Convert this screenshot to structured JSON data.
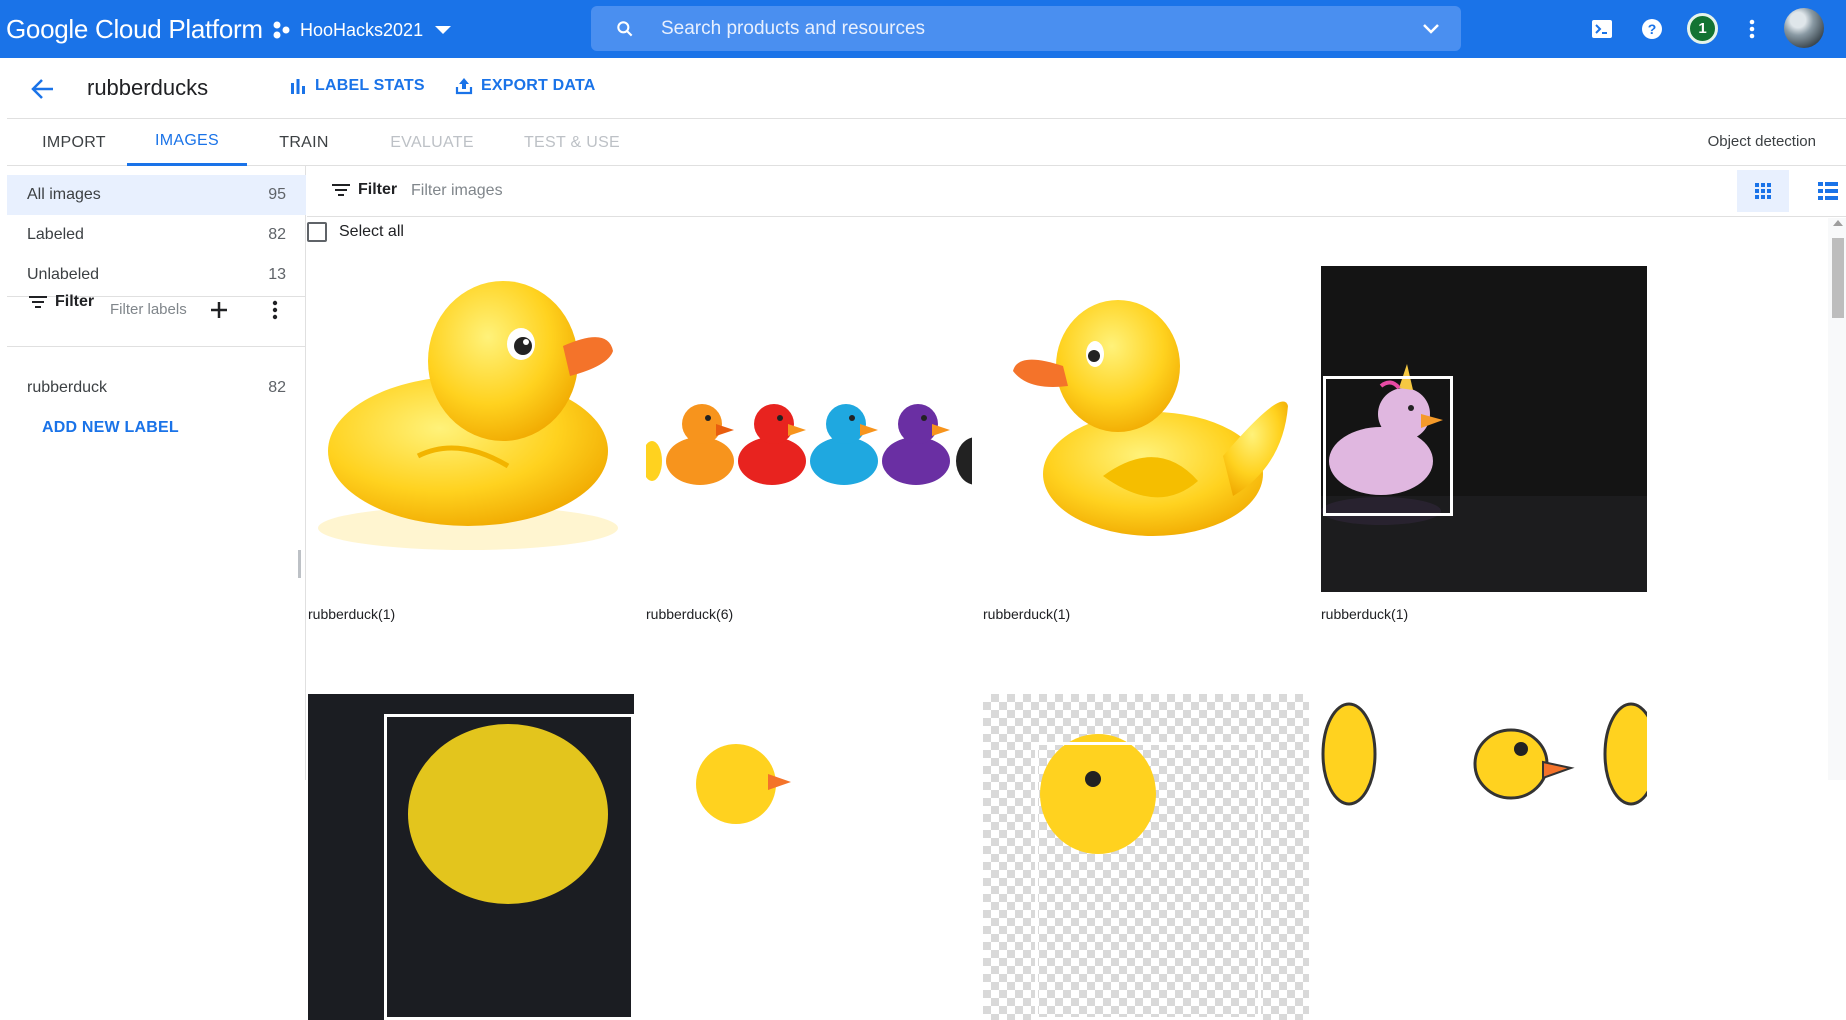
{
  "topbar": {
    "logo": "Google Cloud Platform",
    "project": "HooHacks2021",
    "search_placeholder": "Search products and resources",
    "notification_count": "1"
  },
  "header": {
    "dataset_name": "rubberducks",
    "label_stats": "LABEL STATS",
    "export_data": "EXPORT DATA"
  },
  "tabs": [
    {
      "label": "IMPORT",
      "state": "normal"
    },
    {
      "label": "IMAGES",
      "state": "active"
    },
    {
      "label": "TRAIN",
      "state": "normal"
    },
    {
      "label": "EVALUATE",
      "state": "disabled"
    },
    {
      "label": "TEST & USE",
      "state": "disabled"
    }
  ],
  "mode": "Object detection",
  "sidebar": {
    "filters": [
      {
        "label": "All images",
        "count": "95"
      },
      {
        "label": "Labeled",
        "count": "82"
      },
      {
        "label": "Unlabeled",
        "count": "13"
      }
    ],
    "filter_button": "Filter",
    "filter_labels_placeholder": "Filter labels",
    "labels": [
      {
        "label": "rubberduck",
        "count": "82"
      }
    ],
    "add_label": "ADD NEW LABEL"
  },
  "main": {
    "filter_button": "Filter",
    "filter_placeholder": "Filter images",
    "select_all": "Select all",
    "images": [
      {
        "caption": "rubberduck(1)"
      },
      {
        "caption": "rubberduck(6)"
      },
      {
        "caption": "rubberduck(1)"
      },
      {
        "caption": "rubberduck(1)"
      },
      {
        "caption": ""
      },
      {
        "caption": ""
      },
      {
        "caption": ""
      },
      {
        "caption": ""
      }
    ]
  },
  "colors": {
    "brand_blue": "#1a73e8",
    "duck_yellow": "#ffd21f",
    "beak_orange": "#f4732a"
  }
}
